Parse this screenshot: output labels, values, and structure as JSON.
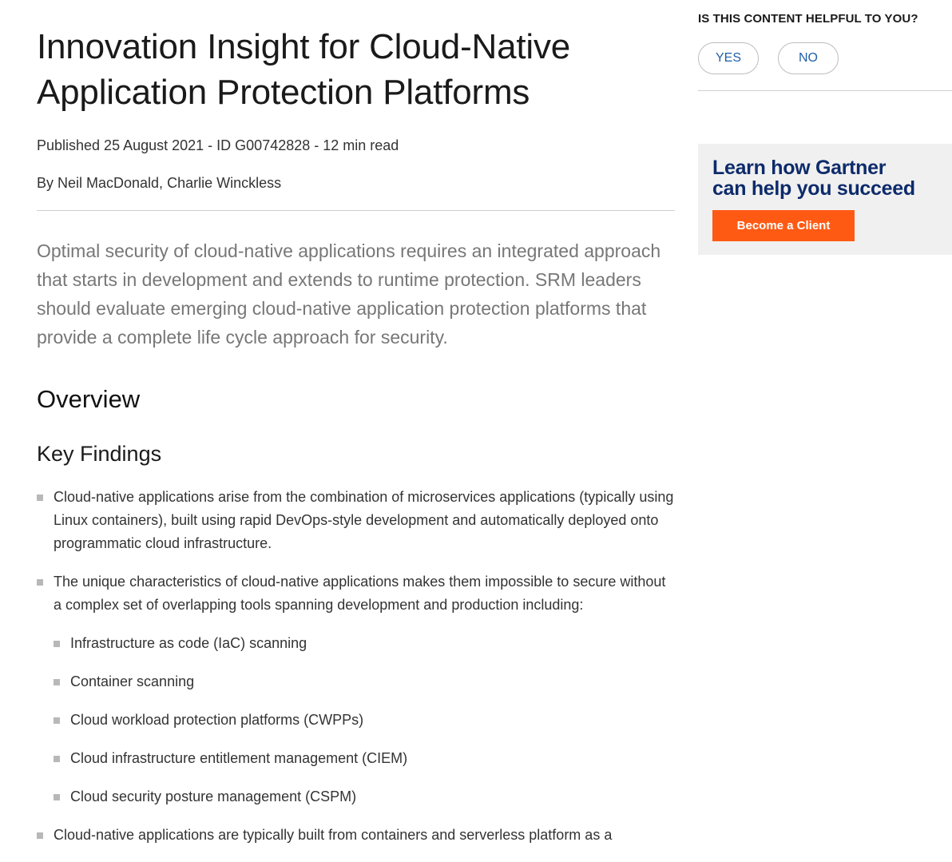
{
  "article": {
    "title": "Innovation Insight for Cloud-Native Application Protection Platforms",
    "meta": "Published 25 August 2021 - ID G00742828 - 12 min read",
    "authors": "By Neil MacDonald, Charlie Winckless",
    "summary": "Optimal security of cloud-native applications requires an integrated approach that starts in development and extends to runtime protection. SRM leaders should evaluate emerging cloud-native application protection platforms that provide a complete life cycle approach for security.",
    "overview_heading": "Overview",
    "key_findings_heading": "Key Findings",
    "findings": [
      "Cloud-native applications arise from the combination of microservices applications (typically using Linux containers), built using rapid DevOps-style development and automatically deployed onto programmatic cloud infrastructure.",
      "The unique characteristics of cloud-native applications makes them impossible to secure without a complex set of overlapping tools spanning development and production including:",
      "Cloud-native applications are typically built from containers and serverless platform as a"
    ],
    "sub_findings": [
      "Infrastructure as code (IaC) scanning",
      "Container scanning",
      "Cloud workload protection platforms (CWPPs)",
      "Cloud infrastructure entitlement management (CIEM)",
      "Cloud security posture management (CSPM)"
    ]
  },
  "feedback": {
    "question": "IS THIS CONTENT HELPFUL TO YOU?",
    "yes_label": "YES",
    "no_label": "NO"
  },
  "promo": {
    "heading_line1": "Learn how Gartner",
    "heading_line2": "can help you succeed",
    "button_label": "Become a Client"
  },
  "colors": {
    "promo_button": "#ff5a14",
    "promo_heading": "#0d2b6b",
    "pill_text": "#1f5fa8",
    "bullet": "#b8b8b8"
  }
}
